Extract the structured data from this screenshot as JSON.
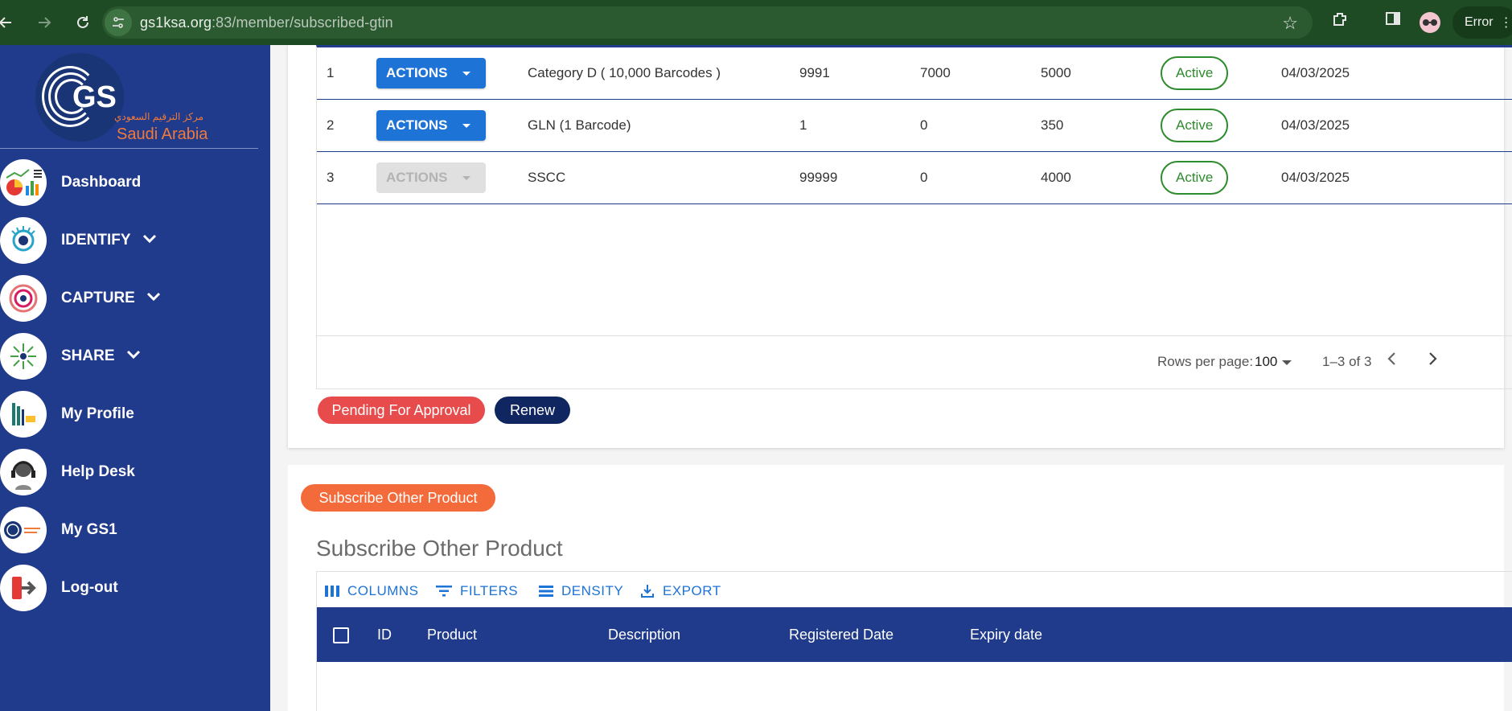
{
  "browser": {
    "url_host": "gs1ksa.org",
    "url_rest": ":83/member/subscribed-gtin",
    "error_label": "Error"
  },
  "sidebar": {
    "logo": {
      "text": "GS",
      "arabic": "مركز الترقيم السعودي",
      "region": "Saudi Arabia"
    },
    "items": [
      {
        "label": "Dashboard",
        "icon": "dashboard-chart-icon",
        "has_chevron": false
      },
      {
        "label": "IDENTIFY",
        "icon": "eye-icon",
        "has_chevron": true
      },
      {
        "label": "CAPTURE",
        "icon": "signal-rings-icon",
        "has_chevron": true
      },
      {
        "label": "SHARE",
        "icon": "share-arrows-icon",
        "has_chevron": true
      },
      {
        "label": "My Profile",
        "icon": "profile-building-icon",
        "has_chevron": false
      },
      {
        "label": "Help Desk",
        "icon": "headset-icon",
        "has_chevron": false
      },
      {
        "label": "My GS1",
        "icon": "gs1-logo-icon",
        "has_chevron": false
      },
      {
        "label": "Log-out",
        "icon": "logout-icon",
        "has_chevron": false
      }
    ]
  },
  "subscribed_table": {
    "rows": [
      {
        "num": "1",
        "action": "ACTIONS",
        "action_enabled": true,
        "product": "Category D ( 10,000 Barcodes )",
        "c1": "9991",
        "c2": "7000",
        "c3": "5000",
        "status": "Active",
        "date": "04/03/2025"
      },
      {
        "num": "2",
        "action": "ACTIONS",
        "action_enabled": true,
        "product": "GLN (1 Barcode)",
        "c1": "1",
        "c2": "0",
        "c3": "350",
        "status": "Active",
        "date": "04/03/2025"
      },
      {
        "num": "3",
        "action": "ACTIONS",
        "action_enabled": false,
        "product": "SSCC",
        "c1": "99999",
        "c2": "0",
        "c3": "4000",
        "status": "Active",
        "date": "04/03/2025"
      }
    ],
    "footer": {
      "rows_per_page_label": "Rows per page:",
      "rows_per_page_value": "100",
      "page_info": "1–3 of 3"
    },
    "buttons": {
      "pending": "Pending For Approval",
      "renew": "Renew"
    }
  },
  "other_product": {
    "subscribe_button": "Subscribe Other Product",
    "title": "Subscribe Other Product",
    "toolbar": [
      "COLUMNS",
      "FILTERS",
      "DENSITY",
      "EXPORT"
    ],
    "columns": [
      "ID",
      "Product",
      "Description",
      "Registered Date",
      "Expiry date"
    ]
  },
  "colors": {
    "sidebar_bg": "#203a8c",
    "browser_bar": "#1f4b24",
    "action_blue": "#1e73d6",
    "active_green": "#2e8b2e",
    "pending_red": "#e84b4b",
    "renew_navy": "#0f2660",
    "subscribe_orange": "#f46b3b"
  }
}
